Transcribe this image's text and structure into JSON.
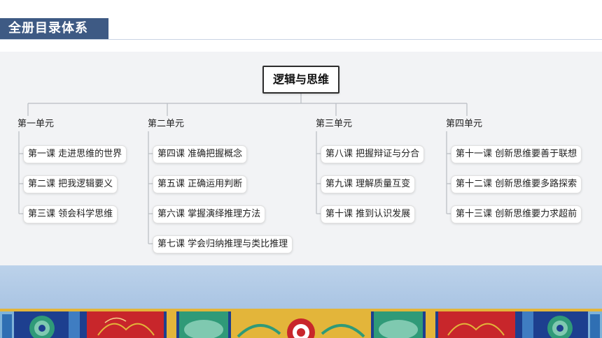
{
  "header": {
    "title": "全册目录体系"
  },
  "diagram": {
    "root": "逻辑与思维",
    "units": [
      {
        "label": "第一单元",
        "lessons": [
          "第一课 走进思维的世界",
          "第二课 把我逻辑要义",
          "第三课 领会科学思维"
        ]
      },
      {
        "label": "第二单元",
        "lessons": [
          "第四课 准确把握概念",
          "第五课 正确运用判断",
          "第六课 掌握演绎推理方法",
          "第七课 学会归纳推理与类比推理"
        ]
      },
      {
        "label": "第三单元",
        "lessons": [
          "第八课 把握辩证与分合",
          "第九课 理解质量互变",
          "第十课 推到认识发展"
        ]
      },
      {
        "label": "第四单元",
        "lessons": [
          "第十一课 创新思维要善于联想",
          "第十二课 创新思维要多路探索",
          "第十三课  创新思维要力求超前"
        ]
      }
    ]
  },
  "colors": {
    "title_bg": "#3e5a84",
    "panel_bg": "#f2f3f5",
    "line": "#b8bcc2",
    "ornament_blue": "#1d3f8f",
    "ornament_red": "#c8262b",
    "ornament_green": "#2f9a78",
    "ornament_gold": "#e3b53a"
  }
}
